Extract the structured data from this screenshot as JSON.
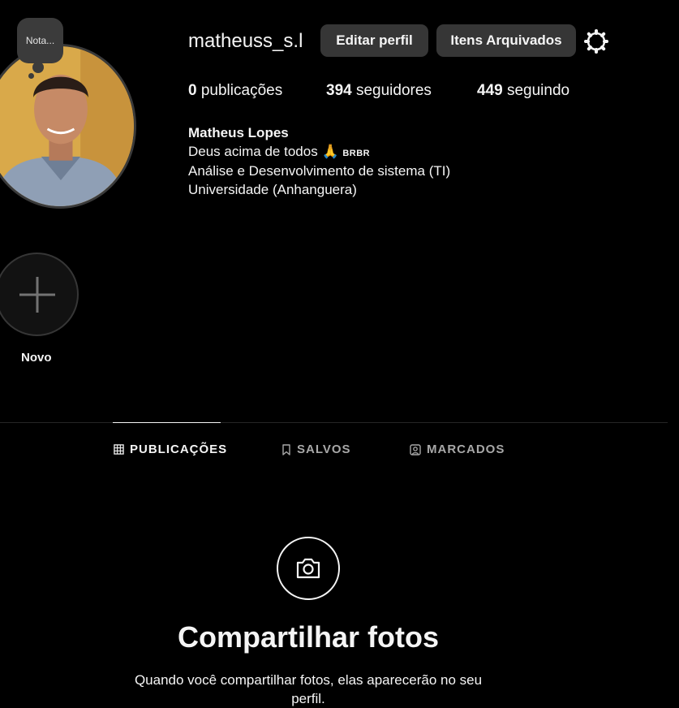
{
  "profile": {
    "note": "Nota...",
    "username": "matheuss_s.l",
    "edit_label": "Editar perfil",
    "archived_label": "Itens Arquivados",
    "stats": {
      "posts_count": "0",
      "posts_label": "publicações",
      "followers_count": "394",
      "followers_label": "seguidores",
      "following_count": "449",
      "following_label": "seguindo"
    },
    "bio": {
      "name": "Matheus Lopes",
      "line1": "Deus acima de todos",
      "emoji": "🙏",
      "badge": "BRBR",
      "line2": "Análise e Desenvolvimento de sistema (TI)",
      "line3": "Universidade (Anhanguera)"
    }
  },
  "highlight": {
    "label": "Novo",
    "icon": "plus-icon"
  },
  "tabs": [
    {
      "label": "PUBLICAÇÕES",
      "icon": "grid-icon",
      "active": true
    },
    {
      "label": "SALVOS",
      "icon": "bookmark-icon",
      "active": false
    },
    {
      "label": "MARCADOS",
      "icon": "tagged-icon",
      "active": false
    }
  ],
  "empty_state": {
    "icon": "camera-icon",
    "title": "Compartilhar fotos",
    "description": "Quando você compartilhar fotos, elas aparecerão no seu perfil."
  },
  "colors": {
    "background": "#000000",
    "button": "#363636",
    "text": "#f5f5f5",
    "muted": "#a8a8a8"
  }
}
